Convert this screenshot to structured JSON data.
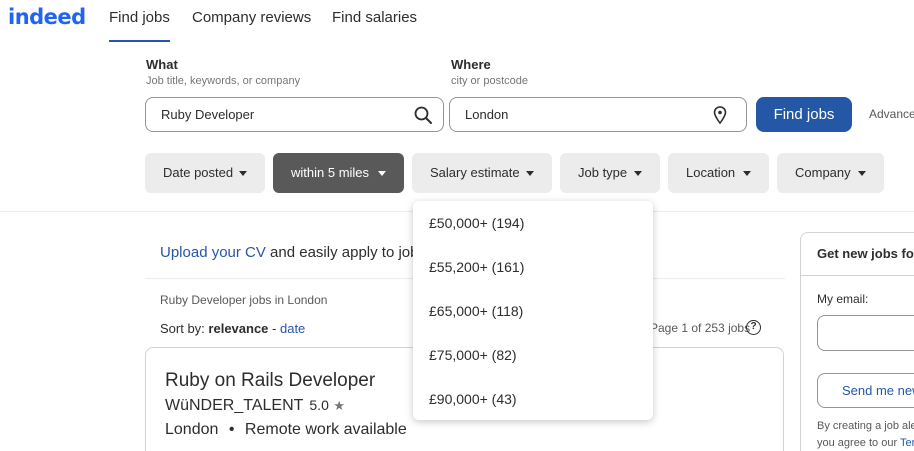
{
  "header": {
    "logo": "indeed",
    "nav": [
      "Find jobs",
      "Company reviews",
      "Find salaries"
    ]
  },
  "search": {
    "what_label": "What",
    "what_sub": "Job title, keywords, or company",
    "what_value": "Ruby Developer",
    "where_label": "Where",
    "where_sub": "city or postcode",
    "where_value": "London",
    "find_button": "Find jobs",
    "advanced": "Advanced"
  },
  "filters": [
    "Date posted",
    "within 5 miles",
    "Salary estimate",
    "Job type",
    "Location",
    "Company"
  ],
  "salary_dropdown": {
    "options": [
      "£50,000+ (194)",
      "£55,200+ (161)",
      "£65,000+ (118)",
      "£75,000+ (82)",
      "£90,000+ (43)"
    ]
  },
  "main": {
    "upload_link": "Upload your CV",
    "upload_rest": " and easily apply to jobs from anywhere",
    "breadcrumb": "Ruby Developer jobs in London",
    "sort_label": "Sort by:",
    "sort_relevance": "relevance",
    "sort_sep": " - ",
    "sort_date": "date",
    "page_count": "Page 1 of 253 jobs",
    "help": "?"
  },
  "job": {
    "title": "Ruby on Rails Developer",
    "company": "WüNDER_TALENT",
    "rating": "5.0",
    "star": "★",
    "location": "London",
    "bullet": "•",
    "remote": "Remote work available"
  },
  "alert_panel": {
    "title": "Get new jobs for this search by email",
    "email_label": "My email:",
    "email_placeholder": "",
    "send_button": "Send me new jobs",
    "fine1": "By creating a job alert,",
    "fine2_pre": "you agree to our ",
    "fine2_link": "Terms"
  },
  "colors": {
    "brand": "#2557a7",
    "logo": "#2164f3",
    "dark_pill": "#595959",
    "pill": "#ececec"
  }
}
